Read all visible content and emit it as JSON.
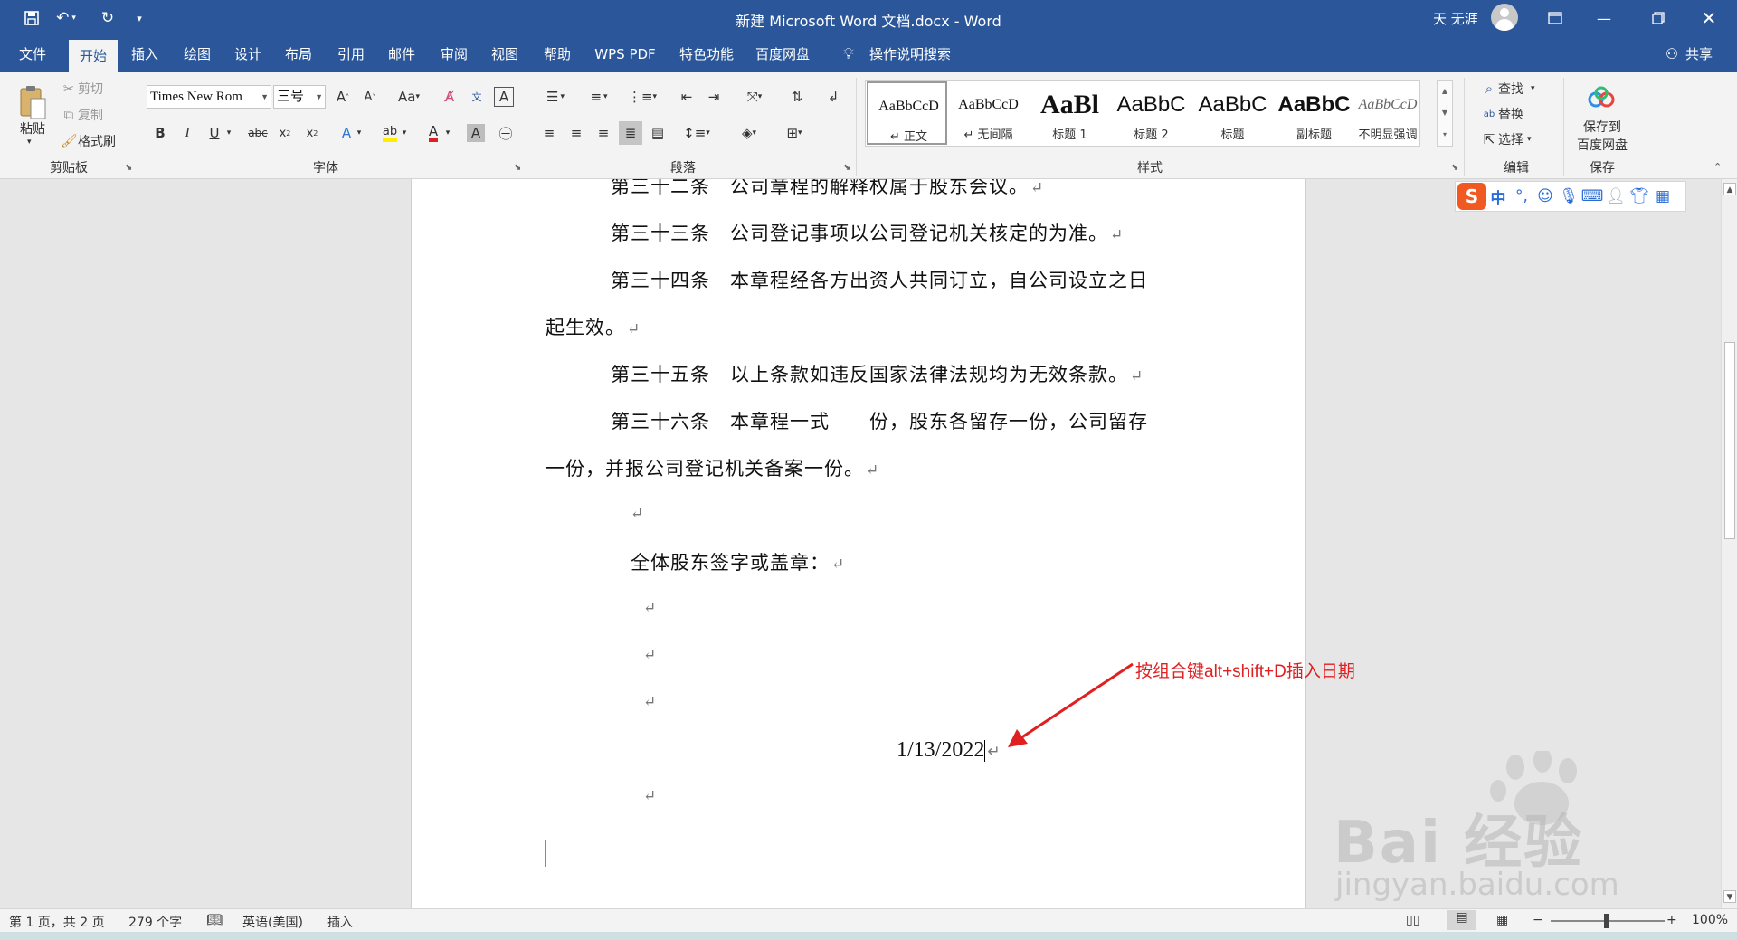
{
  "app": {
    "title": "新建 Microsoft Word 文档.docx  -  Word",
    "user_name": "天 无涯"
  },
  "quick_access": {
    "save_icon": "save-icon",
    "undo_icon": "undo-icon",
    "redo_icon": "redo-icon"
  },
  "tabs": [
    "文件",
    "开始",
    "插入",
    "绘图",
    "设计",
    "布局",
    "引用",
    "邮件",
    "审阅",
    "视图",
    "帮助",
    "WPS PDF",
    "特色功能",
    "百度网盘"
  ],
  "active_tab": "开始",
  "tell_me": "操作说明搜索",
  "share": "共享",
  "ribbon": {
    "clipboard": {
      "paste": "粘贴",
      "cut": "剪切",
      "copy": "复制",
      "format_painter": "格式刷",
      "label": "剪贴板"
    },
    "font": {
      "font_name": "Times New Rom",
      "font_size": "三号",
      "label": "字体"
    },
    "paragraph": {
      "label": "段落"
    },
    "styles": {
      "label": "样式",
      "items": [
        {
          "sample": "AaBbCcD",
          "name": "↵ 正文"
        },
        {
          "sample": "AaBbCcD",
          "name": "↵ 无间隔"
        },
        {
          "sample": "AaBl",
          "name": "标题 1"
        },
        {
          "sample": "AaBbC",
          "name": "标题 2"
        },
        {
          "sample": "AaBbC",
          "name": "标题"
        },
        {
          "sample": "AaBbC",
          "name": "副标题"
        },
        {
          "sample": "AaBbCcD",
          "name": "不明显强调"
        }
      ]
    },
    "editing": {
      "find": "查找",
      "replace": "替换",
      "select": "选择",
      "label": "编辑"
    },
    "save": {
      "button_line1": "保存到",
      "button_line2": "百度网盘",
      "label": "保存"
    }
  },
  "document": {
    "lines": [
      "第三十二条　公司章程的解释权属于股东会议。",
      "第三十三条　公司登记事项以公司登记机关核定的为准。",
      "第三十四条　本章程经各方出资人共同订立，自公司设立之日",
      "起生效。",
      "第三十五条　以上条款如违反国家法律法规均为无效条款。",
      "第三十六条　本章程一式　　份，股东各留存一份，公司留存",
      "一份，并报公司登记机关备案一份。",
      "",
      "全体股东签字或盖章：",
      "",
      "",
      "",
      "1/13/2022",
      ""
    ],
    "paragraph_mark": "↵"
  },
  "annotation": {
    "text": "按组合键alt+shift+D插入日期",
    "color": "#e02020"
  },
  "ime": {
    "logo": "S",
    "mode": "中",
    "punct": "°,"
  },
  "watermark": {
    "text": "Bai 经验",
    "url": "jingyan.baidu.com"
  },
  "status": {
    "page": "第 1 页，共 2 页",
    "words": "279 个字",
    "language": "英语(美国)",
    "mode": "插入",
    "zoom": "100%",
    "zoom_minus": "−",
    "zoom_plus": "+"
  },
  "colors": {
    "title_bar": "#2b579a",
    "ribbon_bg": "#f3f3f3",
    "workspace_bg": "#e6e6e6"
  }
}
